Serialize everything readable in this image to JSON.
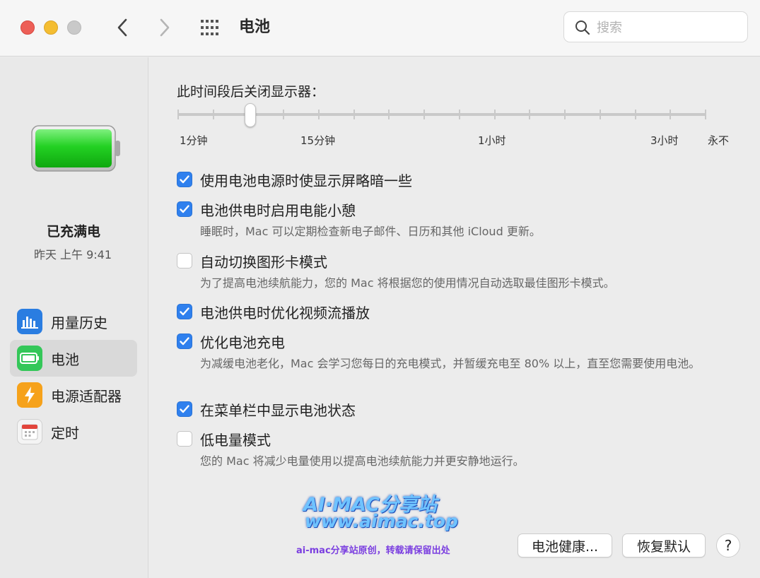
{
  "window": {
    "title": "电池",
    "search_placeholder": "搜索"
  },
  "sidebar": {
    "status_title": "已充满电",
    "status_time": "昨天 上午 9:41",
    "items": [
      {
        "label": "用量历史",
        "icon": "usage-history-icon",
        "active": false
      },
      {
        "label": "电池",
        "icon": "battery-icon",
        "active": true
      },
      {
        "label": "电源适配器",
        "icon": "power-adapter-icon",
        "active": false
      },
      {
        "label": "定时",
        "icon": "schedule-icon",
        "active": false
      }
    ]
  },
  "display_off": {
    "title": "此时间段后关闭显示器：",
    "labels": [
      "1分钟",
      "15分钟",
      "1小时",
      "3小时",
      "永不"
    ],
    "value": "3分钟"
  },
  "options": [
    {
      "label": "使用电池电源时使显示屏略暗一些",
      "checked": true,
      "desc": ""
    },
    {
      "label": "电池供电时启用电能小憩",
      "checked": true,
      "desc": "睡眠时，Mac 可以定期检查新电子邮件、日历和其他 iCloud 更新。"
    },
    {
      "label": "自动切换图形卡模式",
      "checked": false,
      "desc": "为了提高电池续航能力，您的 Mac 将根据您的使用情况自动选取最佳图形卡模式。"
    },
    {
      "label": "电池供电时优化视频流播放",
      "checked": true,
      "desc": ""
    },
    {
      "label": "优化电池充电",
      "checked": true,
      "desc": "为减缓电池老化，Mac 会学习您每日的充电模式，并暂缓充电至 80% 以上，直至您需要使用电池。"
    },
    {
      "label": "在菜单栏中显示电池状态",
      "checked": true,
      "desc": ""
    },
    {
      "label": "低电量模式",
      "checked": false,
      "desc": "您的 Mac 将减少电量使用以提高电池续航能力并更安静地运行。"
    }
  ],
  "watermark": {
    "line1": "AI·MAC分享站",
    "line2": "www.aimac.top",
    "line3": "ai-mac分享站原创，转载请保留出处"
  },
  "buttons": {
    "health": "电池健康...",
    "restore": "恢复默认",
    "help": "?"
  },
  "colors": {
    "accent": "#2f80ee",
    "battery_green": "#2fd52f"
  }
}
